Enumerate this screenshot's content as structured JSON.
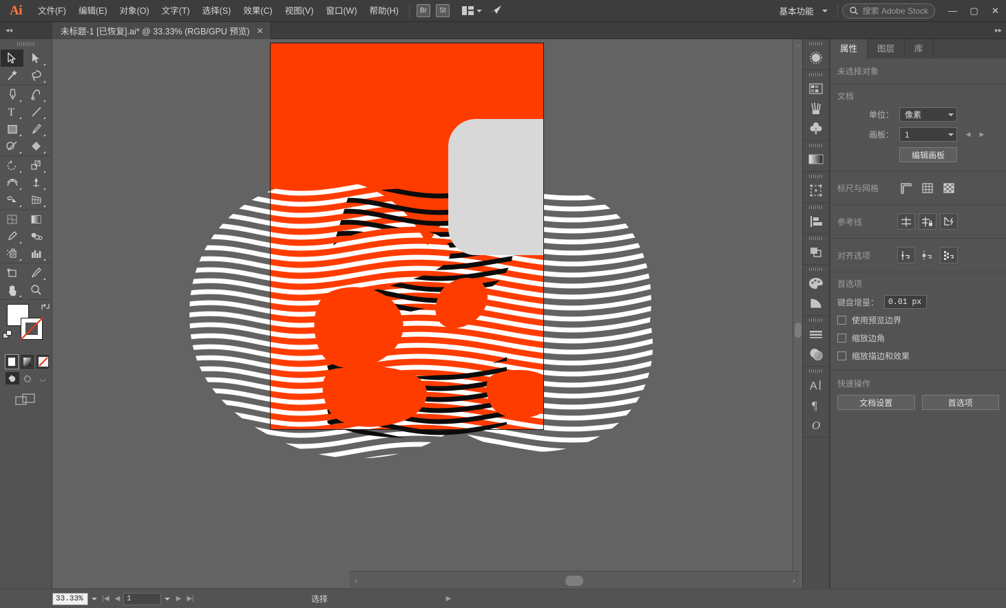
{
  "app": {
    "logo": "Ai",
    "name": "Adobe Illustrator"
  },
  "menubar": {
    "items": [
      {
        "label": "文件(F)"
      },
      {
        "label": "编辑(E)"
      },
      {
        "label": "对象(O)"
      },
      {
        "label": "文字(T)"
      },
      {
        "label": "选择(S)"
      },
      {
        "label": "效果(C)"
      },
      {
        "label": "视图(V)"
      },
      {
        "label": "窗口(W)"
      },
      {
        "label": "帮助(H)"
      }
    ],
    "bridge_label": "Br",
    "stock_label": "St",
    "layout_icon": "arrange-documents-icon",
    "workspace": "基本功能",
    "search_placeholder": "搜索 Adobe Stock",
    "window_minimize": "—",
    "window_maximize": "▢",
    "window_close": "✕"
  },
  "tabbar": {
    "collapse_left": "◂◂",
    "collapse_right": "▸▸",
    "document_title": "未标题-1 [已恢复].ai* @ 33.33% (RGB/GPU 预览)",
    "close_label": "✕"
  },
  "toolbar": {
    "tools": [
      {
        "name": "selection-tool",
        "active": true
      },
      {
        "name": "direct-selection-tool",
        "active": false
      },
      {
        "name": "magic-wand-tool",
        "active": false
      },
      {
        "name": "lasso-tool",
        "active": false
      },
      {
        "name": "pen-tool",
        "active": false
      },
      {
        "name": "curvature-tool",
        "active": false
      },
      {
        "name": "type-tool",
        "active": false
      },
      {
        "name": "line-segment-tool",
        "active": false
      },
      {
        "name": "rectangle-tool",
        "active": false
      },
      {
        "name": "paintbrush-tool",
        "active": false
      },
      {
        "name": "shaper-tool",
        "active": false
      },
      {
        "name": "eraser-tool",
        "active": false
      },
      {
        "name": "rotate-tool",
        "active": false
      },
      {
        "name": "scale-tool",
        "active": false
      },
      {
        "name": "width-tool",
        "active": false
      },
      {
        "name": "free-transform-tool",
        "active": false
      },
      {
        "name": "shape-builder-tool",
        "active": false
      },
      {
        "name": "perspective-grid-tool",
        "active": false
      },
      {
        "name": "mesh-tool",
        "active": false
      },
      {
        "name": "gradient-tool",
        "active": false
      },
      {
        "name": "eyedropper-tool",
        "active": false
      },
      {
        "name": "blend-tool",
        "active": false
      },
      {
        "name": "symbol-sprayer-tool",
        "active": false
      },
      {
        "name": "column-graph-tool",
        "active": false
      },
      {
        "name": "artboard-tool",
        "active": false
      },
      {
        "name": "slice-tool",
        "active": false
      },
      {
        "name": "hand-tool",
        "active": false
      },
      {
        "name": "zoom-tool",
        "active": false
      }
    ],
    "fill_color": "#ffffff",
    "stroke_color": "#ffffff",
    "swap_icon": "swap-fill-stroke-icon",
    "default_icon": "default-fill-stroke-icon",
    "color_modes": [
      {
        "name": "color-mode-button",
        "selected": true
      },
      {
        "name": "gradient-mode-button",
        "selected": false
      },
      {
        "name": "none-mode-button",
        "selected": false
      }
    ],
    "draw_modes": [
      {
        "name": "draw-normal-button",
        "selected": true
      },
      {
        "name": "draw-behind-button",
        "selected": false
      },
      {
        "name": "draw-inside-button",
        "selected": false
      }
    ],
    "screen_mode": "change-screen-mode-icon"
  },
  "canvas": {
    "artboard_fill": "#ff3c00",
    "artwork_colors": {
      "orange": "#ff3c00",
      "white": "#ffffff",
      "black": "#0b0b0b",
      "grey_card": "#d8d8d8"
    },
    "background": "#636363"
  },
  "statusbar": {
    "zoom_level": "33.33%",
    "zoom_dropdown": "chevron-down-icon",
    "first_page": "|◀",
    "prev_page": "◀",
    "page_number": "1",
    "page_dropdown": "chevron-down-icon",
    "next_page": "▶",
    "last_page": "▶|",
    "status_text": "选择",
    "status_menu": "▶",
    "resize_grip": "‹"
  },
  "icondock": {
    "groups": [
      {
        "icons": [
          {
            "name": "brushes-panel-icon"
          }
        ]
      },
      {
        "icons": [
          {
            "name": "swatches-panel-icon"
          },
          {
            "name": "brush-libraries-panel-icon"
          },
          {
            "name": "symbols-panel-icon"
          }
        ]
      },
      {
        "icons": [
          {
            "name": "gradient-panel-icon"
          }
        ]
      },
      {
        "icons": [
          {
            "name": "transform-panel-icon"
          }
        ]
      },
      {
        "icons": [
          {
            "name": "align-panel-icon"
          }
        ]
      },
      {
        "icons": [
          {
            "name": "pathfinder-panel-icon"
          }
        ]
      },
      {
        "icons": [
          {
            "name": "color-panel-icon"
          },
          {
            "name": "color-guide-panel-icon"
          }
        ]
      },
      {
        "icons": [
          {
            "name": "stroke-panel-icon"
          },
          {
            "name": "transparency-panel-icon"
          }
        ]
      },
      {
        "icons": [
          {
            "name": "character-panel-icon"
          },
          {
            "name": "paragraph-panel-icon"
          },
          {
            "name": "glyphs-panel-icon"
          }
        ]
      }
    ]
  },
  "properties": {
    "tabs": [
      {
        "label": "属性",
        "active": true
      },
      {
        "label": "图层",
        "active": false
      },
      {
        "label": "库",
        "active": false
      }
    ],
    "no_selection": "未选择对象",
    "document": {
      "title": "文档",
      "units_label": "单位：",
      "units_value": "像素",
      "artboard_label": "画板：",
      "artboard_value": "1",
      "prev_artboard": "◀",
      "next_artboard": "▶",
      "edit_artboards_label": "编辑画板"
    },
    "rulers_grids": {
      "title": "标尺与网格",
      "buttons": [
        {
          "name": "show-rulers-icon"
        },
        {
          "name": "show-grid-icon"
        },
        {
          "name": "show-transparency-grid-icon"
        }
      ]
    },
    "guides": {
      "title": "参考线",
      "buttons": [
        {
          "name": "show-guides-icon"
        },
        {
          "name": "lock-guides-icon"
        },
        {
          "name": "smart-guides-icon"
        }
      ]
    },
    "snap": {
      "title": "对齐选项",
      "buttons": [
        {
          "name": "snap-to-point-icon"
        },
        {
          "name": "snap-to-grid-icon"
        },
        {
          "name": "snap-to-pixel-icon"
        }
      ]
    },
    "preferences": {
      "title": "首选项",
      "keyboard_increment_label": "键盘增量：",
      "keyboard_increment_value": "0.01 px",
      "checkboxes": [
        {
          "label": "使用预览边界",
          "checked": false
        },
        {
          "label": "缩放边角",
          "checked": false
        },
        {
          "label": "缩放描边和效果",
          "checked": false
        }
      ]
    },
    "quick_actions": {
      "title": "快速操作",
      "buttons": [
        {
          "label": "文档设置"
        },
        {
          "label": "首选项"
        }
      ]
    }
  }
}
